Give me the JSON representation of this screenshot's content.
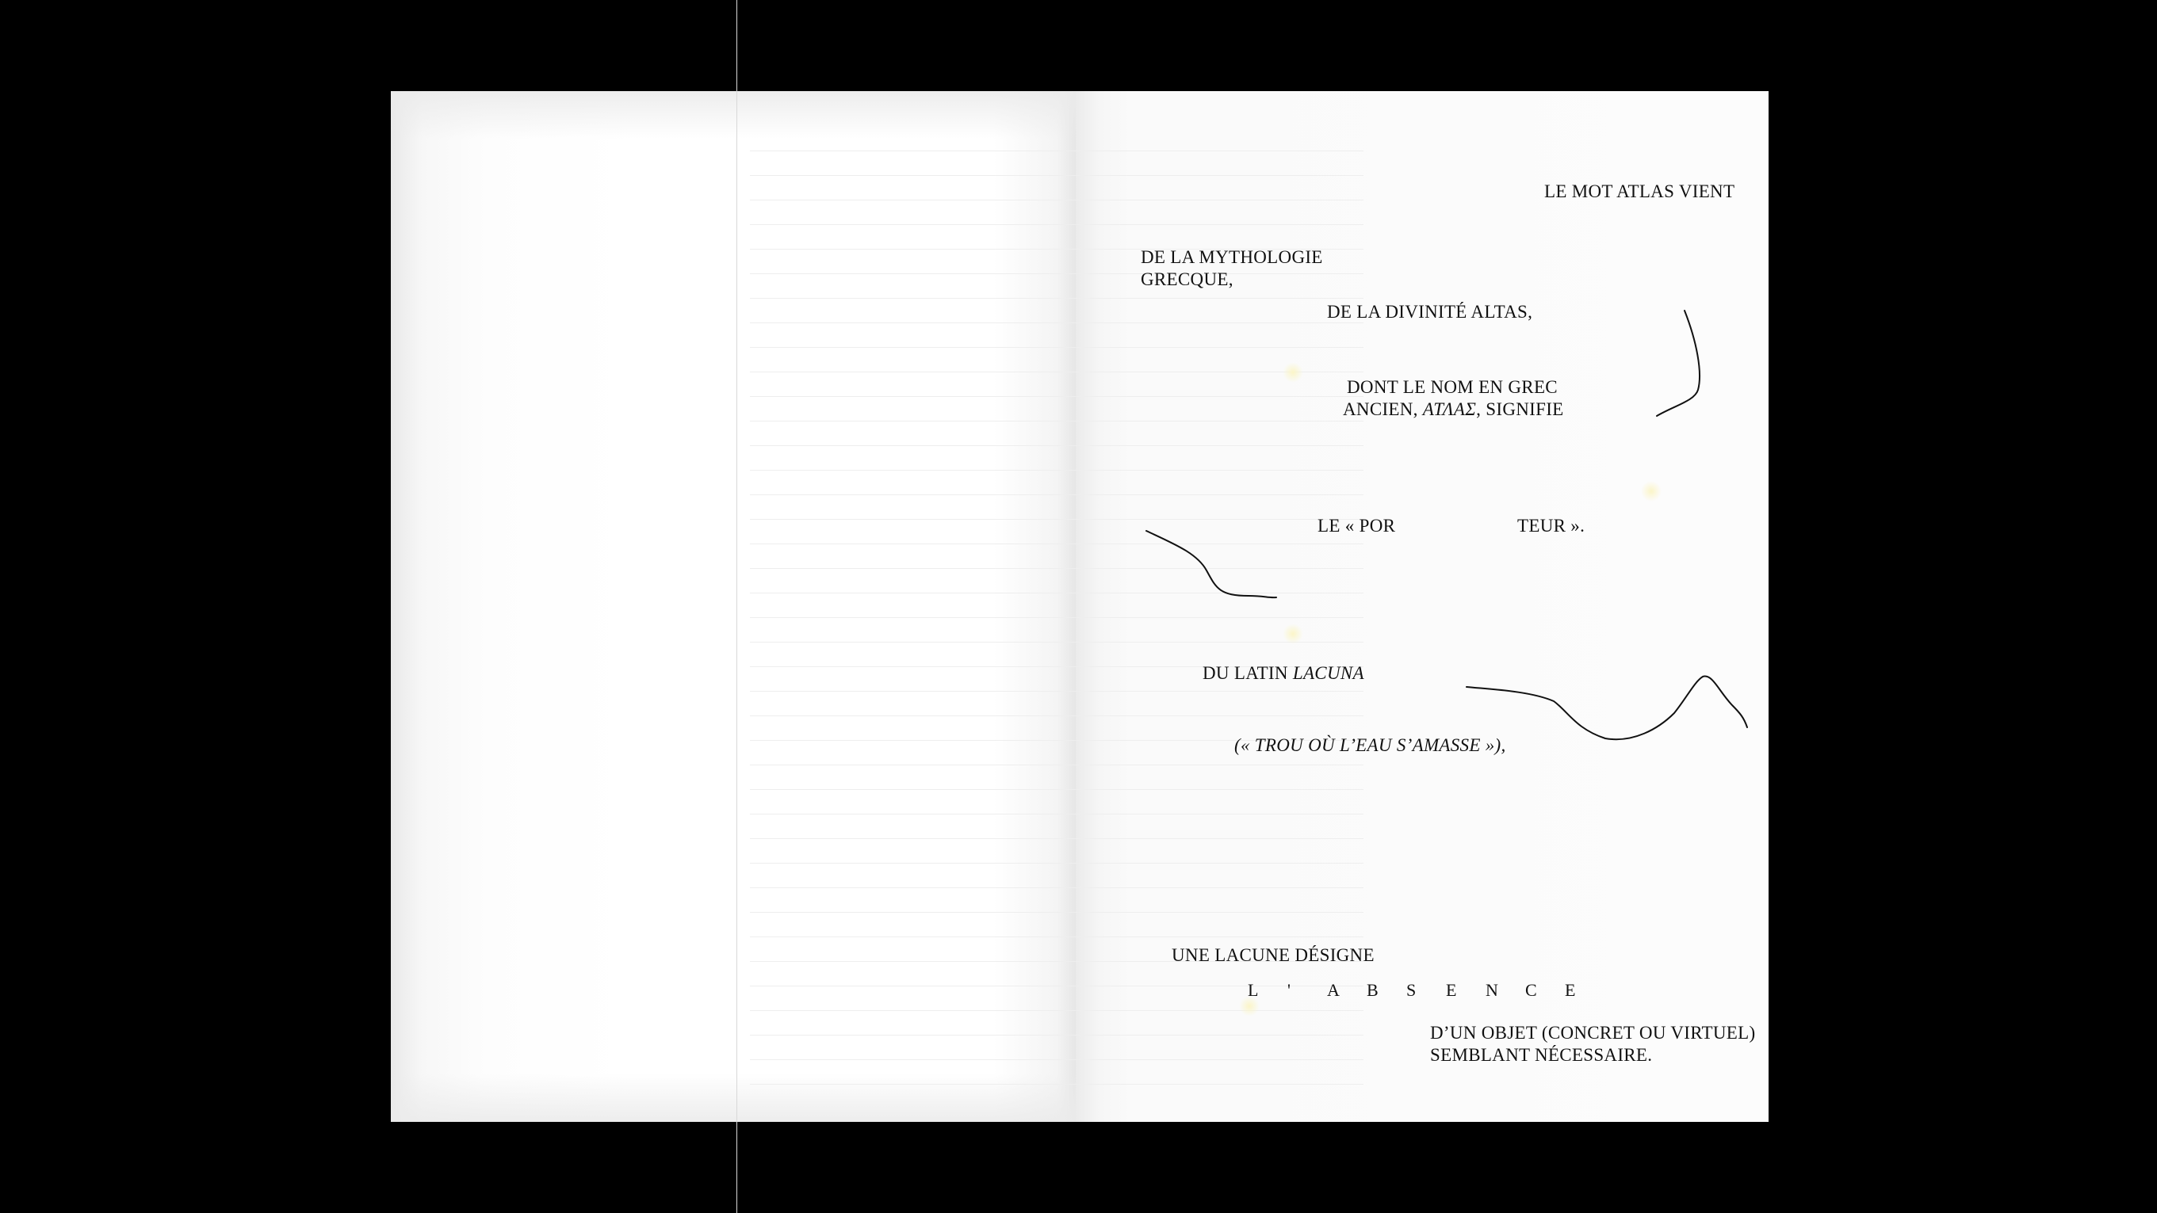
{
  "page": {
    "background": "#000000",
    "paper": "#ffffff",
    "ink": "#111111"
  },
  "text": {
    "line1": "LE MOT ATLAS VIENT",
    "line2a": "DE LA MYTHOLOGIE",
    "line2b": "GRECQUE,",
    "line3": "DE LA DIVINITÉ ALTAS,",
    "line4a": "DONT LE NOM EN GREC",
    "line4b_pre": "ANCIEN, ",
    "line4b_greek": "ΑΤΛΑΣ",
    "line4b_post": ", SIGNIFIE",
    "line5a": "LE « POR",
    "line5b": "TEUR ».",
    "line6_pre": "DU LATIN ",
    "line6_italic": "LACUNA",
    "line7": "(« TROU OÙ L’EAU S’AMASSE »),",
    "line8": "UNE LACUNE DÉSIGNE",
    "absence_letters": [
      "L",
      "'",
      "A",
      "B",
      "S",
      "E",
      "N",
      "C",
      "E"
    ],
    "line9a": "D’UN OBJET (CONCRET OU VIRTUEL)",
    "line9b": "SEMBLANT NÉCESSAIRE."
  }
}
